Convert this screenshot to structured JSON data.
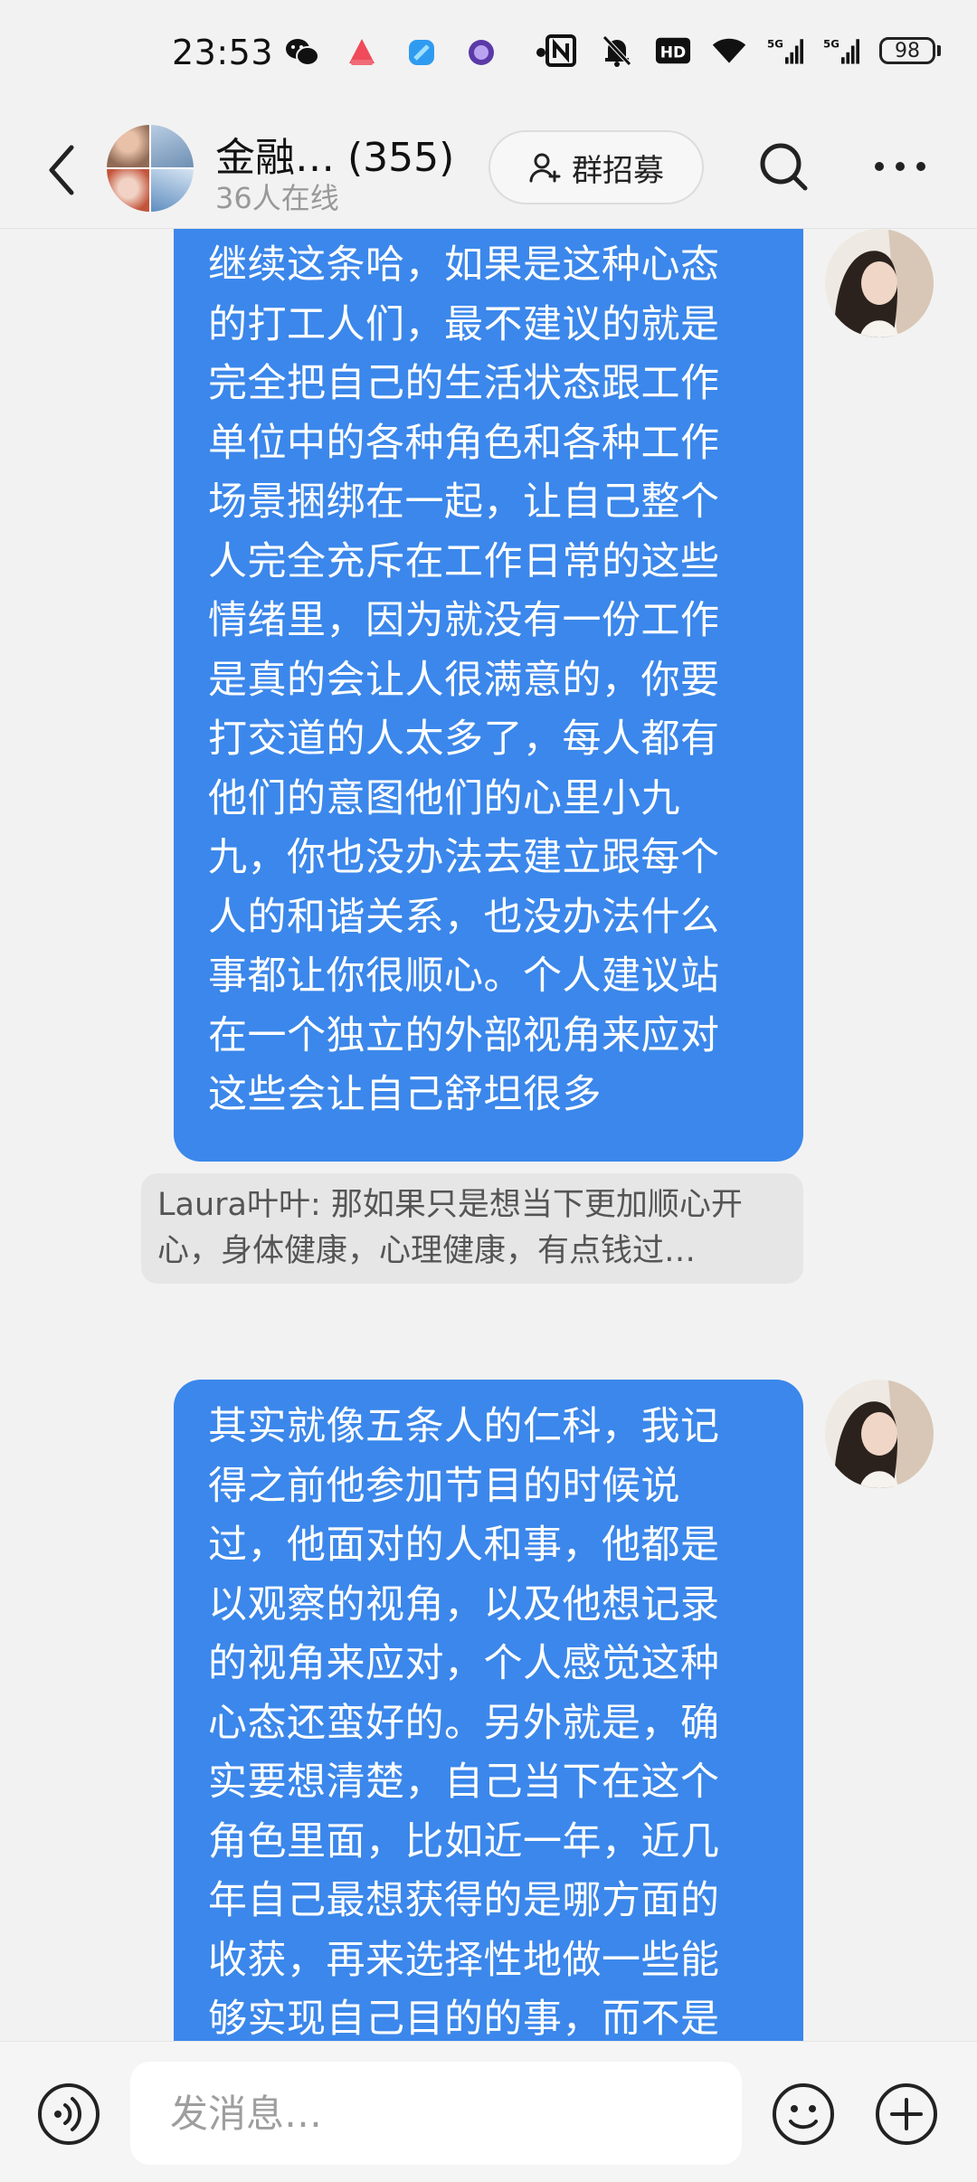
{
  "status_bar": {
    "time": "23:53",
    "battery": "98",
    "left_icons": [
      "wechat-icon",
      "app-red-icon",
      "app-blue-icon",
      "app-purple-icon",
      "dot-icon"
    ],
    "right_icons": [
      "nfc-icon",
      "mute-bell-icon",
      "hd-icon",
      "wifi-icon",
      "signal-5g-icon",
      "signal-5g-icon"
    ]
  },
  "header": {
    "title": "金融… (355)",
    "online": "36人在线",
    "recruit_label": "群招募"
  },
  "messages": [
    {
      "lines": [
        "继续这条哈，如果是这种心态",
        "的打工人们，最不建议的就是",
        "完全把自己的生活状态跟工作",
        "单位中的各种角色和各种工作",
        "场景捆绑在一起，让自己整个",
        "人完全充斥在工作日常的这些",
        "情绪里，因为就没有一份工作",
        "是真的会让人很满意的，你要",
        "打交道的人太多了，每人都有",
        "他们的意图他们的心里小九",
        "九，你也没办法去建立跟每个",
        "人的和谐关系，也没办法什么",
        "事都让你很顺心。个人建议站",
        "在一个独立的外部视角来应对",
        "这些会让自己舒坦很多"
      ]
    },
    {
      "lines": [
        "其实就像五条人的仁科，我记",
        "得之前他参加节目的时候说",
        "过，他面对的人和事，他都是",
        "以观察的视角，以及他想记录",
        "的视角来应对，个人感觉这种",
        "心态还蛮好的。另外就是，确",
        "实要想清楚，自己当下在这个",
        "角色里面，比如近一年，近几",
        "年自己最想获得的是哪方面的",
        "收获，再来选择性地做一些能",
        "够实现自己目的的事，而不是"
      ]
    }
  ],
  "quote": {
    "line1": "Laura叶叶: 那如果只是想当下更加顺心开",
    "line2": "心，身体健康，心理健康，有点钱过…"
  },
  "input": {
    "placeholder": "发消息…"
  },
  "colors": {
    "bubble": "#3b87eb",
    "background": "#f2f2f2"
  }
}
